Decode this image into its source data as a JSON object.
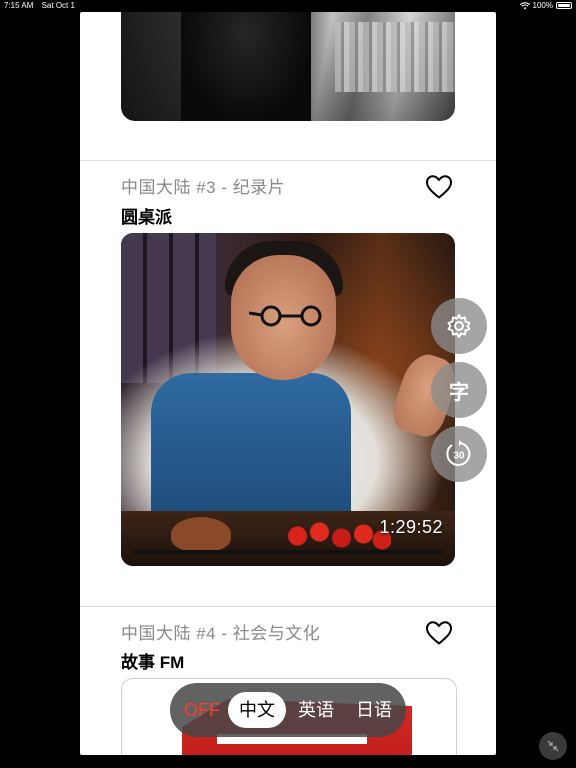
{
  "status_bar": {
    "time": "7:15 AM",
    "date": "Sat Oct 1",
    "battery": "100%"
  },
  "episodes": [
    {
      "meta": "中国大陆 #3 - 纪录片",
      "title": "圆桌派",
      "duration": "1:29:52"
    },
    {
      "meta": "中国大陆 #4 - 社会与文化",
      "title": "故事 FM"
    }
  ],
  "side_controls": {
    "subtitle_label": "字",
    "skip_label": "30"
  },
  "language_bar": {
    "off": "OFF",
    "zh": "中文",
    "en": "英语",
    "ja": "日语",
    "selected": "中文"
  },
  "colors": {
    "off": "#ff3b30",
    "panel": "#ffffff",
    "meta": "#8a8a8a"
  },
  "icons": [
    "wifi-icon",
    "battery-icon",
    "heart-icon",
    "gear-icon",
    "subtitle-icon",
    "replay-30-icon",
    "minimize-icon"
  ]
}
